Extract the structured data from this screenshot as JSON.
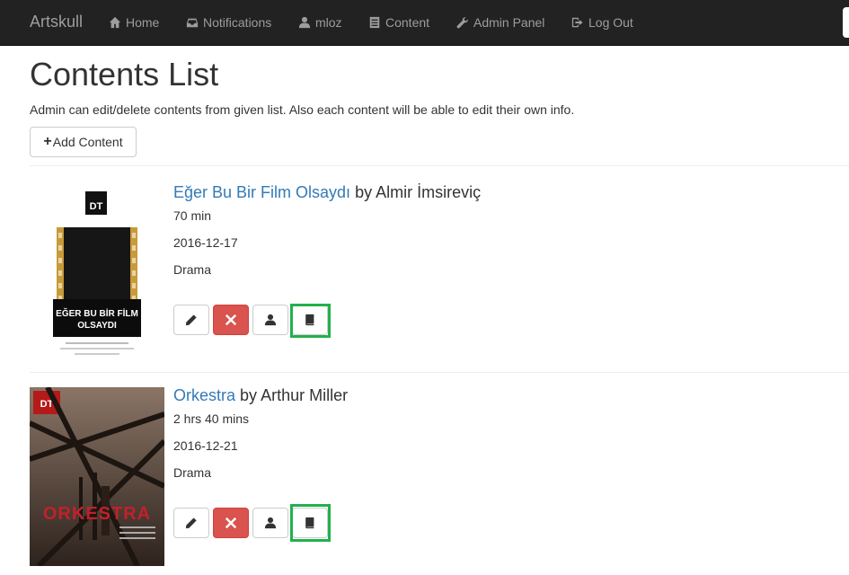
{
  "navbar": {
    "brand": "Artskull",
    "items": [
      {
        "label": "Home",
        "icon": "home-icon"
      },
      {
        "label": "Notifications",
        "icon": "inbox-icon"
      },
      {
        "label": "mloz",
        "icon": "user-icon"
      },
      {
        "label": "Content",
        "icon": "list-icon"
      },
      {
        "label": "Admin Panel",
        "icon": "wrench-icon"
      },
      {
        "label": "Log Out",
        "icon": "logout-icon"
      }
    ]
  },
  "page": {
    "title": "Contents List",
    "description": "Admin can edit/delete contents from given list. Also each content will be able to edit their own info.",
    "add_button": "Add Content"
  },
  "contents": [
    {
      "title": "Eğer Bu Bir Film Olsaydı",
      "by": "by",
      "author": "Almir İmsireviç",
      "duration": "70 min",
      "date": "2016-12-17",
      "genre": "Drama",
      "poster_text": [
        "DT",
        "EĞER BU BİR FİLM",
        "OLSAYDI"
      ]
    },
    {
      "title": "Orkestra",
      "by": "by",
      "author": "Arthur Miller",
      "duration": "2 hrs 40 mins",
      "date": "2016-12-21",
      "genre": "Drama",
      "poster_text": [
        "DT",
        "ORKESTRA"
      ]
    }
  ],
  "colors": {
    "navbar_bg": "#222222",
    "link": "#337ab7",
    "danger": "#d9534f",
    "highlight": "#22b14c"
  }
}
